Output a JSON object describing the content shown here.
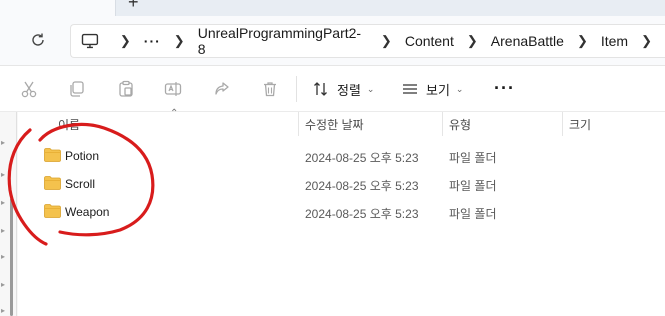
{
  "window": {
    "new_tab_label": "+"
  },
  "breadcrumb": {
    "more": "···",
    "items": [
      "UnrealProgrammingPart2-8",
      "Content",
      "ArenaBattle",
      "Item"
    ]
  },
  "toolbar": {
    "sort_label": "정렬",
    "view_label": "보기",
    "more_label": "···"
  },
  "columns": {
    "name": "이름",
    "modified": "수정한 날짜",
    "type": "유형",
    "size": "크기"
  },
  "files": [
    {
      "name": "Potion",
      "modified": "2024-08-25 오후 5:23",
      "type": "파일 폴더",
      "size": ""
    },
    {
      "name": "Scroll",
      "modified": "2024-08-25 오후 5:23",
      "type": "파일 폴더",
      "size": ""
    },
    {
      "name": "Weapon",
      "modified": "2024-08-25 오후 5:23",
      "type": "파일 폴더",
      "size": ""
    }
  ],
  "colors": {
    "annotation": "#d81c1c",
    "folder": "#f4c24d"
  }
}
